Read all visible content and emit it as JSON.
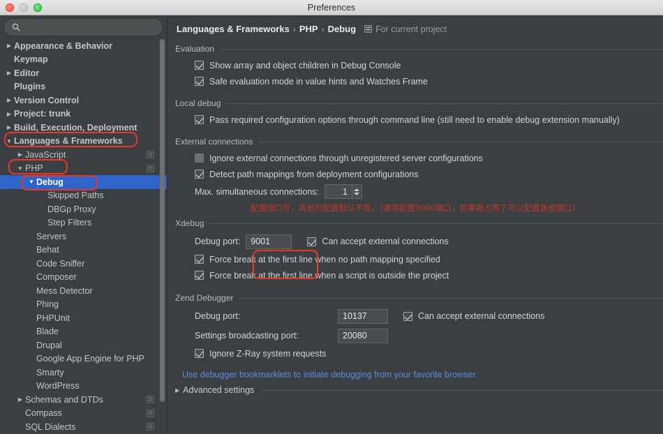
{
  "window": {
    "title": "Preferences",
    "controls": {
      "close": "close-button",
      "minimize": "minimize-button",
      "maximize": "maximize-button"
    }
  },
  "sidebar": {
    "search": {
      "value": "",
      "placeholder": ""
    },
    "items": [
      {
        "label": "Appearance & Behavior",
        "arrow": "▶",
        "indent": 0,
        "bold": true,
        "selected": false,
        "config_icon": false
      },
      {
        "label": "Keymap",
        "arrow": "",
        "indent": 0,
        "bold": true,
        "selected": false,
        "config_icon": false
      },
      {
        "label": "Editor",
        "arrow": "▶",
        "indent": 0,
        "bold": true,
        "selected": false,
        "config_icon": false
      },
      {
        "label": "Plugins",
        "arrow": "",
        "indent": 0,
        "bold": true,
        "selected": false,
        "config_icon": false
      },
      {
        "label": "Version Control",
        "arrow": "▶",
        "indent": 0,
        "bold": true,
        "selected": false,
        "config_icon": false
      },
      {
        "label": "Project: trunk",
        "arrow": "▶",
        "indent": 0,
        "bold": true,
        "selected": false,
        "config_icon": false
      },
      {
        "label": "Build, Execution, Deployment",
        "arrow": "▶",
        "indent": 0,
        "bold": true,
        "selected": false,
        "config_icon": false
      },
      {
        "label": "Languages & Frameworks",
        "arrow": "▼",
        "indent": 0,
        "bold": true,
        "selected": false,
        "config_icon": false
      },
      {
        "label": "JavaScript",
        "arrow": "▶",
        "indent": 1,
        "bold": false,
        "selected": false,
        "config_icon": true
      },
      {
        "label": "PHP",
        "arrow": "▼",
        "indent": 1,
        "bold": false,
        "selected": false,
        "config_icon": true
      },
      {
        "label": "Debug",
        "arrow": "▼",
        "indent": 2,
        "bold": true,
        "selected": true,
        "config_icon": false
      },
      {
        "label": "Skipped Paths",
        "arrow": "",
        "indent": 3,
        "bold": false,
        "selected": false,
        "config_icon": false
      },
      {
        "label": "DBGp Proxy",
        "arrow": "",
        "indent": 3,
        "bold": false,
        "selected": false,
        "config_icon": false
      },
      {
        "label": "Step Filters",
        "arrow": "",
        "indent": 3,
        "bold": false,
        "selected": false,
        "config_icon": false
      },
      {
        "label": "Servers",
        "arrow": "",
        "indent": 2,
        "bold": false,
        "selected": false,
        "config_icon": false
      },
      {
        "label": "Behat",
        "arrow": "",
        "indent": 2,
        "bold": false,
        "selected": false,
        "config_icon": false
      },
      {
        "label": "Code Sniffer",
        "arrow": "",
        "indent": 2,
        "bold": false,
        "selected": false,
        "config_icon": false
      },
      {
        "label": "Composer",
        "arrow": "",
        "indent": 2,
        "bold": false,
        "selected": false,
        "config_icon": false
      },
      {
        "label": "Mess Detector",
        "arrow": "",
        "indent": 2,
        "bold": false,
        "selected": false,
        "config_icon": false
      },
      {
        "label": "Phing",
        "arrow": "",
        "indent": 2,
        "bold": false,
        "selected": false,
        "config_icon": false
      },
      {
        "label": "PHPUnit",
        "arrow": "",
        "indent": 2,
        "bold": false,
        "selected": false,
        "config_icon": false
      },
      {
        "label": "Blade",
        "arrow": "",
        "indent": 2,
        "bold": false,
        "selected": false,
        "config_icon": false
      },
      {
        "label": "Drupal",
        "arrow": "",
        "indent": 2,
        "bold": false,
        "selected": false,
        "config_icon": false
      },
      {
        "label": "Google App Engine for PHP",
        "arrow": "",
        "indent": 2,
        "bold": false,
        "selected": false,
        "config_icon": false
      },
      {
        "label": "Smarty",
        "arrow": "",
        "indent": 2,
        "bold": false,
        "selected": false,
        "config_icon": false
      },
      {
        "label": "WordPress",
        "arrow": "",
        "indent": 2,
        "bold": false,
        "selected": false,
        "config_icon": false
      },
      {
        "label": "Schemas and DTDs",
        "arrow": "▶",
        "indent": 1,
        "bold": false,
        "selected": false,
        "config_icon": true
      },
      {
        "label": "Compass",
        "arrow": "",
        "indent": 1,
        "bold": false,
        "selected": false,
        "config_icon": true
      },
      {
        "label": "SQL Dialects",
        "arrow": "",
        "indent": 1,
        "bold": false,
        "selected": false,
        "config_icon": true
      }
    ]
  },
  "breadcrumb": {
    "crumb1": "Languages & Frameworks",
    "sep1": "›",
    "crumb2": "PHP",
    "sep2": "›",
    "crumb3": "Debug",
    "scope": "For current project"
  },
  "sections": {
    "evaluation": {
      "title": "Evaluation",
      "options": [
        {
          "label": "Show array and object children in Debug Console",
          "checked": true
        },
        {
          "label": "Safe evaluation mode in value hints and Watches Frame",
          "checked": true
        }
      ]
    },
    "local_debug": {
      "title": "Local debug",
      "options": [
        {
          "label": "Pass required configuration options through command line (still need to enable debug extension manually)",
          "checked": true
        }
      ]
    },
    "external_connections": {
      "title": "External connections",
      "options": [
        {
          "label": "Ignore external connections through unregistered server configurations",
          "checked": false
        },
        {
          "label": "Detect path mappings from deployment configurations",
          "checked": true
        }
      ],
      "max_connections_label": "Max. simultaneous connections:",
      "max_connections_value": "1",
      "annotation_note": "配置端口号，其他的配置默认不变。（通常配置9000端口，如果被占用了可以配置其他端口）"
    },
    "xdebug": {
      "title": "Xdebug",
      "debug_port_label": "Debug port:",
      "debug_port_value": "9001",
      "accept_external_label": "Can accept external connections",
      "accept_external_checked": true,
      "options": [
        {
          "label": "Force break at the first line when no path mapping specified",
          "checked": true
        },
        {
          "label": "Force break at the first line when a script is outside the project",
          "checked": true
        }
      ]
    },
    "zend": {
      "title": "Zend Debugger",
      "debug_port_label": "Debug port:",
      "debug_port_value": "10137",
      "accept_external_label": "Can accept external connections",
      "accept_external_checked": true,
      "broadcast_label": "Settings broadcasting port:",
      "broadcast_value": "20080",
      "ignore_zray_label": "Ignore Z-Ray system requests",
      "ignore_zray_checked": true
    },
    "footer": {
      "bookmarklets_link": "Use debugger bookmarklets to initiate debugging from your favorite browser",
      "advanced_settings": "Advanced settings",
      "advanced_arrow": "▶"
    }
  },
  "colors": {
    "accent_selection": "#2f65ca",
    "annotation_red": "#e8392a",
    "note_red": "#c0392b",
    "link_blue": "#5a8cdc",
    "panel_bg": "#3c3f41"
  }
}
